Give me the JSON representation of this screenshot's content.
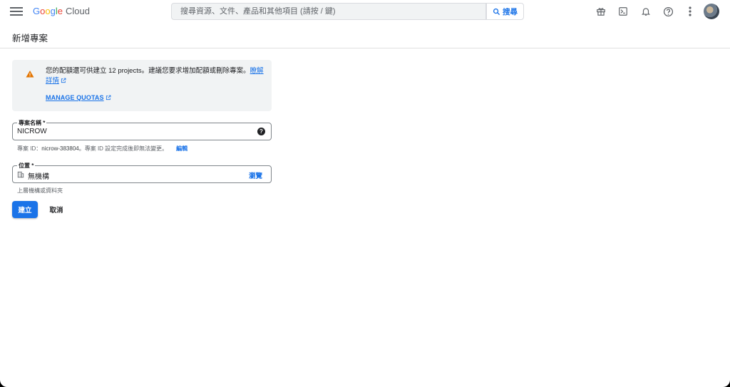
{
  "topbar": {
    "logo_google": "Google",
    "logo_cloud": "Cloud",
    "search_placeholder": "搜尋資源、文件、產品和其他項目 (請按 / 鍵)",
    "search_button": "搜尋",
    "icons": [
      "menu-icon",
      "gift-icon",
      "terminal-icon",
      "bell-icon",
      "help-icon",
      "more-vert-icon",
      "avatar"
    ]
  },
  "page": {
    "title": "新增專案"
  },
  "warning": {
    "text": "您的配額還可供建立 12 projects。建議您要求增加配額或刪除專案。",
    "learn_more": "瞭解詳情",
    "manage_quotas": "MANAGE QUOTAS"
  },
  "project_name": {
    "label": "專案名稱 *",
    "value": "NICROW",
    "hint_prefix": "專案 ID：",
    "project_id": "nicrow-383804",
    "hint_suffix": "。專案 ID 設定完成後即無法變更。",
    "edit": "編輯"
  },
  "location": {
    "label": "位置 *",
    "value": "無機構",
    "browse": "瀏覽",
    "hint": "上層機構或資料夾"
  },
  "actions": {
    "create": "建立",
    "cancel": "取消"
  },
  "colors": {
    "accent": "#1a73e8",
    "warning": "#e37400",
    "panel": "#f1f3f4"
  }
}
